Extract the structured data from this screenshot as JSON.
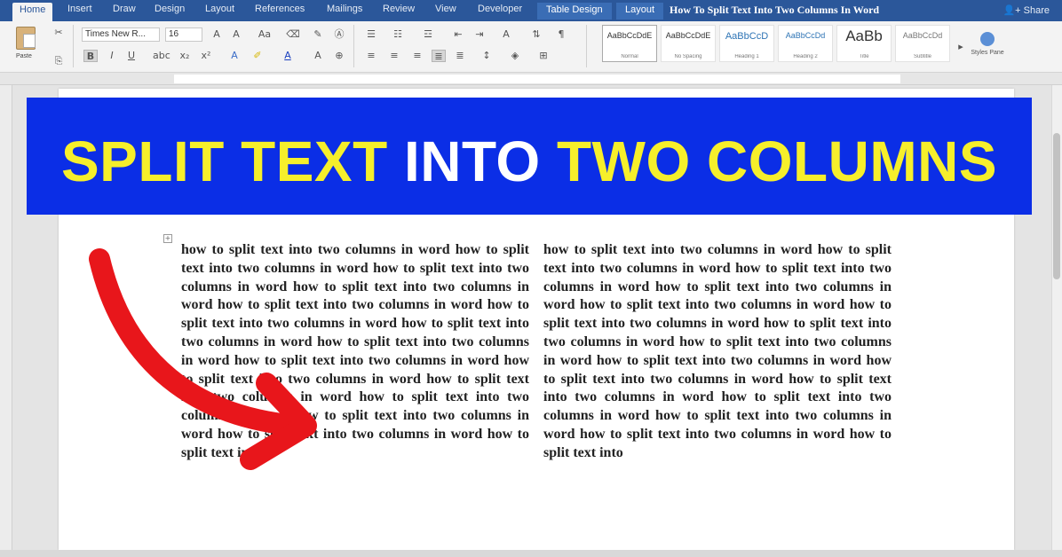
{
  "ribbon": {
    "tabs": [
      "Home",
      "Insert",
      "Draw",
      "Design",
      "Layout",
      "References",
      "Mailings",
      "Review",
      "View",
      "Developer"
    ],
    "context_tabs": [
      "Table Design",
      "Layout"
    ],
    "share_label": "Share",
    "paste_label": "Paste",
    "font_name": "Times New R...",
    "font_size": "16",
    "styles": [
      {
        "sample": "AaBbCcDdE",
        "name": "Normal"
      },
      {
        "sample": "AaBbCcDdE",
        "name": "No Spacing"
      },
      {
        "sample": "AaBbCcD",
        "name": "Heading 1"
      },
      {
        "sample": "AaBbCcDd",
        "name": "Heading 2"
      },
      {
        "sample": "AaBb",
        "name": "Title"
      },
      {
        "sample": "AaBbCcDd",
        "name": "Subtitle"
      }
    ],
    "styles_pane_label": "Styles Pane"
  },
  "document": {
    "title": "How To Split Text Into Two Columns In Word",
    "banner": {
      "part1": "SPLIT TEXT ",
      "part2": "INTO ",
      "part3": "TWO COLUMNS",
      "background": "#0b2ee6",
      "yellow": "#f6ef2b"
    },
    "left_column": "how to split text into two columns in word how to split text into two columns in word how to split text into two columns in word how to split text into two columns in word how to split text into two columns in word how to split text into two columns in word how to split text into two columns in word how to split text into two columns in word how to split text into two columns in word how to split text into two columns in word how to split text into two columns in word how to split text into two columns in word how to split text into two columns in word how to split text into two columns in word how to split text into",
    "right_column": "how to split text into two columns in word how to split text into two columns in word how to split text into two columns in word how to split text into two columns in word how to split text into two columns in word how to split text into two columns in word how to split text into two columns in word how to split text into two columns in word how to split text into two columns in word how to split text into two columns in word how to split text into two columns in word how to split text into two columns in word how to split text into two columns in word how to split text into two columns in word how to split text into",
    "arrow_color": "#e8161b"
  }
}
